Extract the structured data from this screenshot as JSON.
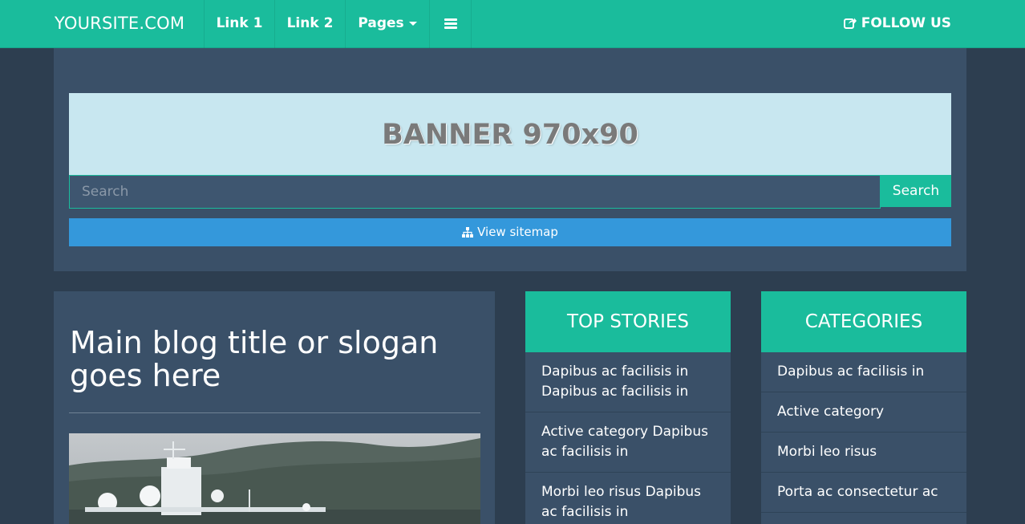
{
  "navbar": {
    "brand": "YOURSITE.COM",
    "links": [
      "Link 1",
      "Link 2",
      "Pages"
    ],
    "menu_icon": "bars-icon",
    "follow": "FOLLOW US",
    "follow_icon": "share-square-icon"
  },
  "header": {
    "banner": "BANNER 970x90",
    "search_placeholder": "Search",
    "search_button": "Search",
    "sitemap": "View sitemap",
    "sitemap_icon": "sitemap-icon"
  },
  "main": {
    "title": "Main blog title or slogan goes here"
  },
  "top_stories": {
    "title": "TOP STORIES",
    "items": [
      "Dapibus ac facilisis in Dapibus ac facilisis in",
      "Active category Dapibus ac facilisis in",
      "Morbi leo risus Dapibus ac facilisis in"
    ]
  },
  "categories": {
    "title": "CATEGORIES",
    "items": [
      "Dapibus ac facilisis in",
      "Active category",
      "Morbi leo risus",
      "Porta ac consectetur ac"
    ]
  },
  "colors": {
    "accent": "#1abc9c",
    "background": "#2d3e50",
    "panel": "#3a5068",
    "banner": "#c8e7f0",
    "sitemap": "#3498db"
  }
}
